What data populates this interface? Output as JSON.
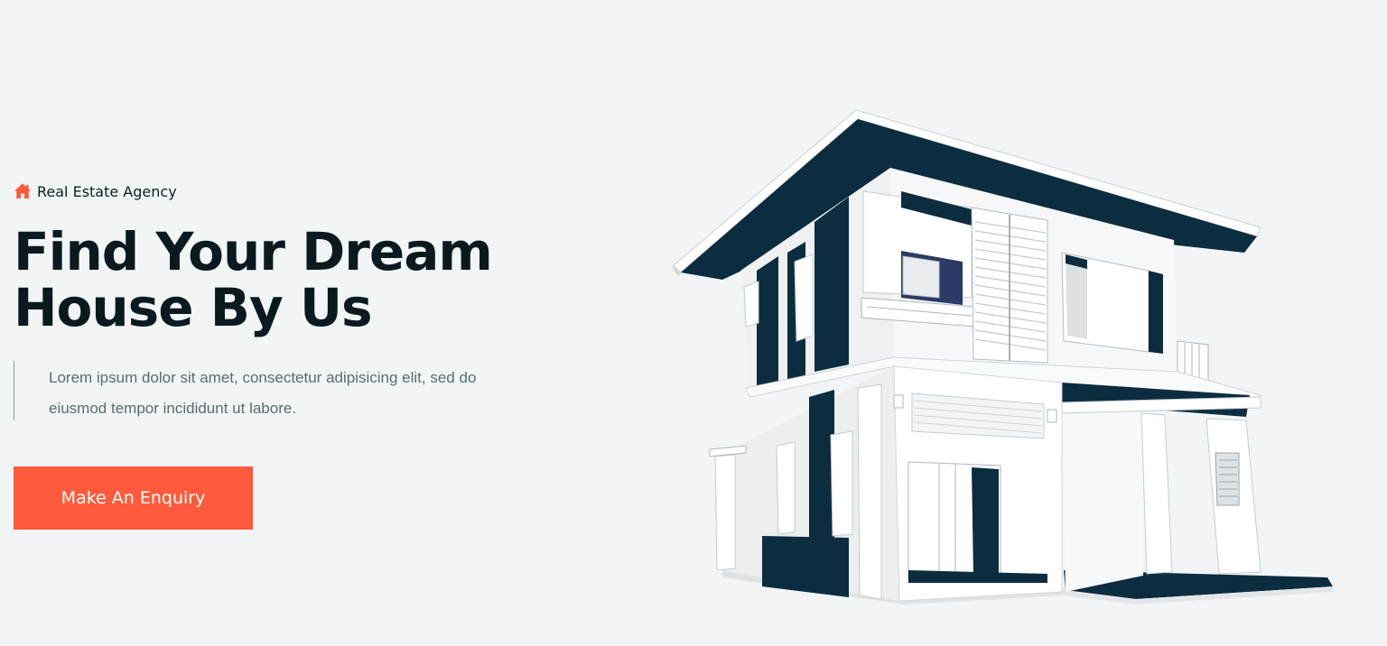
{
  "hero": {
    "eyebrow": "Real Estate Agency",
    "title_line1": "Find Your Dream",
    "title_line2": "House By Us",
    "description": "Lorem ipsum dolor sit amet, consectetur adipisicing elit, sed do eiusmod tempor incididunt ut labore.",
    "cta_label": "Make An Enquiry"
  },
  "icons": {
    "eyebrow_icon": "home-icon"
  },
  "colors": {
    "accent": "#ff5a3c",
    "heading": "#0a1a1f",
    "body_text": "#5b6b72",
    "background": "#f1f5f6",
    "house_dark": "#0c2d3f"
  }
}
